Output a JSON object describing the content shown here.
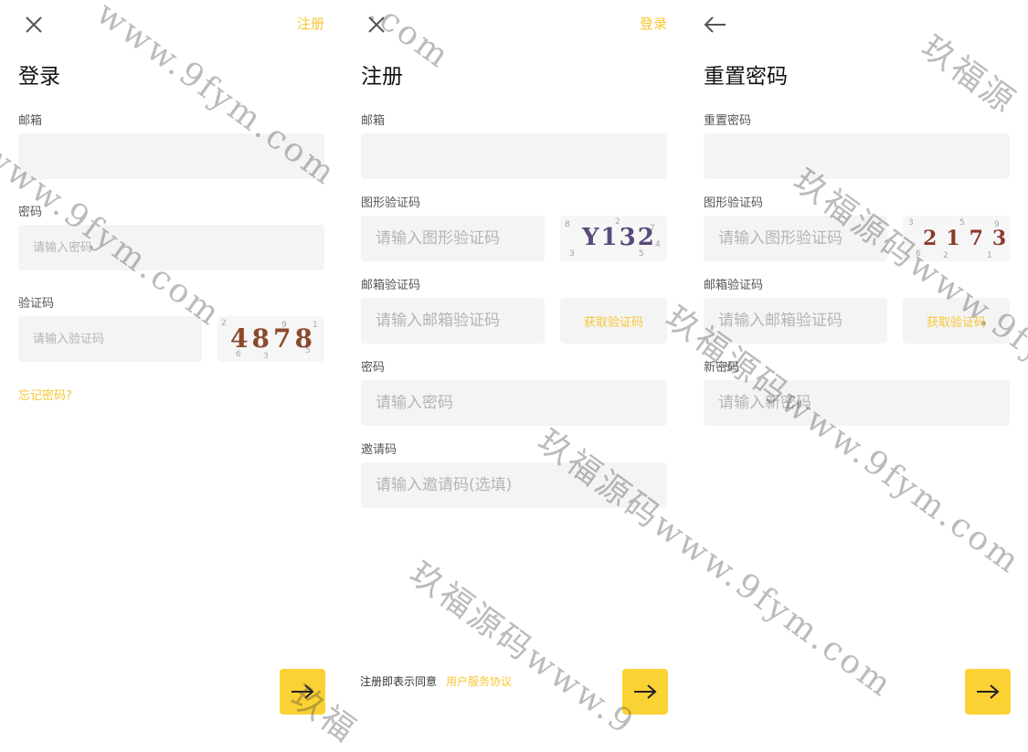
{
  "login": {
    "close_icon": "close-icon",
    "switch_link": "注册",
    "title": "登录",
    "email_label": "邮箱",
    "email_placeholder": "",
    "password_label": "密码",
    "password_placeholder": "请输入密码",
    "captcha_label": "验证码",
    "captcha_placeholder": "请输入验证码",
    "captcha_text": "4878",
    "forgot": "忘记密码?",
    "submit_icon": "arrow-right-icon"
  },
  "register": {
    "close_icon": "close-icon",
    "switch_link": "登录",
    "title": "注册",
    "email_label": "邮箱",
    "email_placeholder": "",
    "image_captcha_label": "图形验证码",
    "image_captcha_placeholder": "请输入图形验证码",
    "captcha_text": "Y132",
    "email_code_label": "邮箱验证码",
    "email_code_placeholder": "请输入邮箱验证码",
    "get_code": "获取验证码",
    "password_label": "密码",
    "password_placeholder": "请输入密码",
    "invite_label": "邀请码",
    "invite_placeholder": "请输入邀请码(选填)",
    "agree_text": "注册即表示同意",
    "agreement_link": "用户服务协议",
    "submit_icon": "arrow-right-icon"
  },
  "reset": {
    "back_icon": "arrow-left-icon",
    "title": "重置密码",
    "reset_label": "重置密码",
    "reset_placeholder": "",
    "image_captcha_label": "图形验证码",
    "image_captcha_placeholder": "请输入图形验证码",
    "captcha_text": "2173",
    "email_code_label": "邮箱验证码",
    "email_code_placeholder": "请输入邮箱验证码",
    "get_code": "获取验证码",
    "new_password_label": "新密码",
    "new_password_placeholder": "请输入新密码",
    "submit_icon": "arrow-right-icon"
  },
  "watermarks": [
    "www.9fym.com",
    "www.9fym.com",
    ".com",
    "玖福源",
    "玖福源码www.9fym.com",
    "玖福源码www.9fym.com",
    "玖福源码www.9fym.com",
    "玖福源码www.9",
    "玖福"
  ],
  "colors": {
    "accent": "#f7c733",
    "button": "#fbd233",
    "field_bg": "#f4f4f5"
  }
}
